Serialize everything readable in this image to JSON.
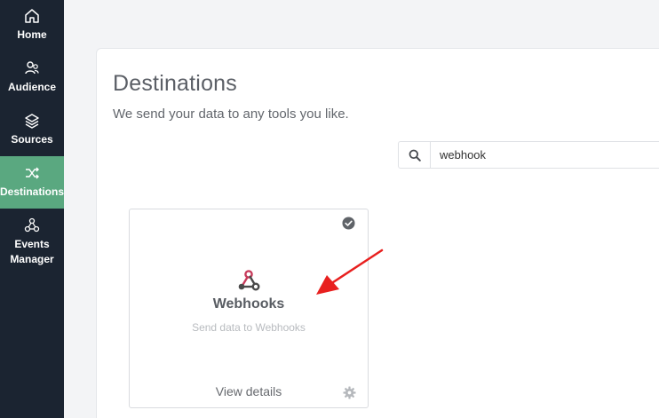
{
  "sidebar": {
    "items": [
      {
        "label": "Home",
        "icon": "home-icon"
      },
      {
        "label": "Audience",
        "icon": "audience-icon"
      },
      {
        "label": "Sources",
        "icon": "layers-icon"
      },
      {
        "label": "Destinations",
        "icon": "shuffle-icon",
        "active": true
      },
      {
        "label": "Events",
        "label2": "Manager",
        "icon": "events-icon"
      }
    ],
    "colors": {
      "background": "#1b2431",
      "active": "#5aa880"
    }
  },
  "main": {
    "title": "Destinations",
    "subtitle": "We send your data to any tools you like.",
    "search": {
      "value": "webhook",
      "icon": "search-icon"
    }
  },
  "card": {
    "name": "Webhooks",
    "description": "Send data to Webhooks",
    "details_label": "View details",
    "status_icon": "check-circle-icon",
    "settings_icon": "gear-icon",
    "logo_icon": "webhook-logo-icon"
  },
  "annotation": {
    "icon": "red-arrow-icon",
    "color": "#e8201f"
  }
}
